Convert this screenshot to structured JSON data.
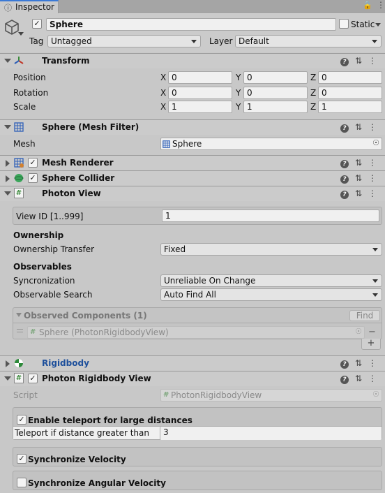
{
  "tab": {
    "title": "Inspector"
  },
  "object": {
    "name": "Sphere",
    "static_label": "Static",
    "tag_label": "Tag",
    "tag_value": "Untagged",
    "layer_label": "Layer",
    "layer_value": "Default"
  },
  "transform": {
    "title": "Transform",
    "rows": [
      {
        "label": "Position",
        "x": "0",
        "y": "0",
        "z": "0"
      },
      {
        "label": "Rotation",
        "x": "0",
        "y": "0",
        "z": "0"
      },
      {
        "label": "Scale",
        "x": "1",
        "y": "1",
        "z": "1"
      }
    ],
    "axis": {
      "x": "X",
      "y": "Y",
      "z": "Z"
    }
  },
  "mesh_filter": {
    "title": "Sphere (Mesh Filter)",
    "mesh_label": "Mesh",
    "mesh_value": "Sphere"
  },
  "mesh_renderer": {
    "title": "Mesh Renderer"
  },
  "sphere_collider": {
    "title": "Sphere Collider"
  },
  "photon_view": {
    "title": "Photon View",
    "view_id_label": "View ID [1..999]",
    "view_id_value": "1",
    "ownership_heading": "Ownership",
    "ownership_transfer_label": "Ownership Transfer",
    "ownership_transfer_value": "Fixed",
    "observables_heading": "Observables",
    "sync_label": "Syncronization",
    "sync_value": "Unreliable On Change",
    "search_label": "Observable Search",
    "search_value": "Auto Find All",
    "observed_title": "Observed Components (1)",
    "find_label": "Find",
    "observed_item": "Sphere (PhotonRigidbodyView)",
    "minus": "−",
    "plus": "+"
  },
  "rigidbody": {
    "title": "Rigidbody"
  },
  "photon_rigidbody_view": {
    "title": "Photon Rigidbody View",
    "script_label": "Script",
    "script_value": "PhotonRigidbodyView",
    "teleport_label": "Enable teleport for large distances",
    "teleport_distance_label": "Teleport if distance greater than",
    "teleport_distance_value": "3",
    "sync_velocity_label": "Synchronize Velocity",
    "sync_angular_label": "Synchronize Angular Velocity"
  },
  "colors": {
    "rigidbody_title": "#1d4f9b",
    "header_bg": "#cbcbcb",
    "panel_bg": "#c8c8c8"
  }
}
